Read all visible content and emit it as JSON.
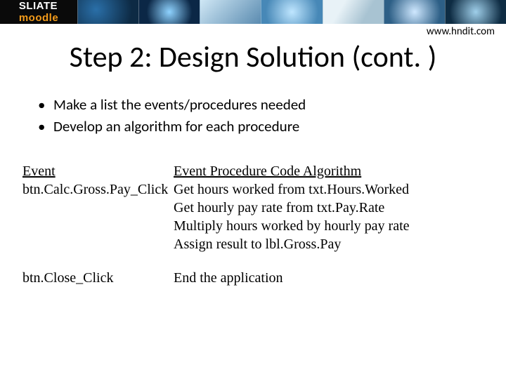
{
  "header": {
    "logo_part1": "SLIATE",
    "logo_part2": "moodle",
    "url": "www.hndit.com"
  },
  "title": "Step 2:  Design Solution (cont. )",
  "bullets": [
    "Make a list the events/procedures needed",
    "Develop an algorithm for each procedure"
  ],
  "table": {
    "header_event": "Event",
    "header_algo": "Event Procedure Code Algorithm",
    "rows": [
      {
        "event": "btn.Calc.Gross.Pay_Click",
        "algo": [
          "Get hours worked from txt.Hours.Worked",
          "Get hourly pay rate from txt.Pay.Rate",
          "Multiply hours worked by hourly pay rate",
          "Assign result to lbl.Gross.Pay"
        ]
      },
      {
        "event": "btn.Close_Click",
        "algo": [
          "End the application"
        ]
      }
    ]
  }
}
